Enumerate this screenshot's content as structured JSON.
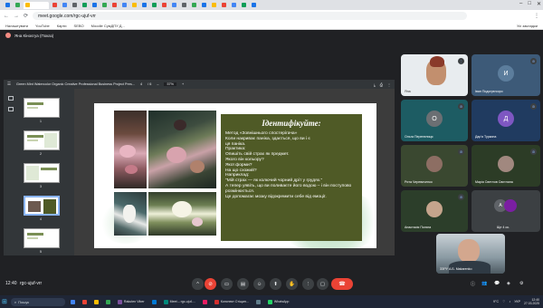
{
  "browser": {
    "tabs": [
      {
        "label": "",
        "color": "#1a73e8"
      },
      {
        "label": "",
        "color": "#34a853"
      },
      {
        "label": "",
        "color": "#fbbc04"
      },
      {
        "label": "",
        "color": "#ea4335"
      },
      {
        "label": "",
        "color": "#4285f4"
      },
      {
        "label": "",
        "color": "#5f6368"
      },
      {
        "label": "",
        "color": "#0f9d58"
      },
      {
        "label": "",
        "color": "#1a73e8"
      },
      {
        "label": "",
        "color": "#34a853"
      },
      {
        "label": "",
        "color": "#ea4335"
      },
      {
        "label": "",
        "color": "#4285f4"
      },
      {
        "label": "",
        "color": "#fbbc04"
      },
      {
        "label": "",
        "color": "#1a73e8"
      },
      {
        "label": "",
        "color": "#0f9d58"
      },
      {
        "label": "",
        "color": "#ea4335"
      },
      {
        "label": "",
        "color": "#4285f4"
      },
      {
        "label": "",
        "color": "#5f6368"
      },
      {
        "label": "",
        "color": "#34a853"
      },
      {
        "label": "",
        "color": "#1a73e8"
      },
      {
        "label": "",
        "color": "#fbbc04"
      },
      {
        "label": "",
        "color": "#ea4335"
      },
      {
        "label": "",
        "color": "#4285f4"
      },
      {
        "label": "",
        "color": "#0f9d58"
      },
      {
        "label": "",
        "color": "#1a73e8"
      }
    ],
    "url": "meet.google.com/rgc-ujuf-vrr",
    "bookmarks": [
      "Налаштувати",
      "YouTube",
      "Карти",
      "SEBO",
      "Moodle СумДПУ Д..."
    ],
    "all_bookmarks": "Усі закладки"
  },
  "meet": {
    "presenter_label": "Яна Кіноєгуа (Показ)",
    "file_name": "Green Mint Watercolor Organic Creative Professional Business Project Pres...",
    "page_current": "4",
    "page_total": "/ 6",
    "zoom": "57%",
    "thumb_numbers": [
      "1",
      "2",
      "3",
      "4",
      "5"
    ],
    "slide": {
      "title": "Ідентифікуйте:",
      "lines": [
        "Метод «Зовнішнього спостерігача»",
        "Коли накриває паніка, здається, що ви і є",
        "ця паніка.",
        "Практика:",
        "Опишіть свій страх як предмет.",
        "Якого він кольору?",
        "Якої форми?",
        "На що схожий?",
        "Наприклад:",
        "\"Мій страх — як колючий чорний дріт у грудях.\"",
        "А тепер уявіть, що ви поливаєте його водою – і він поступово розмінюється.",
        "Це допомагає мозку відокремити себе від емоції."
      ]
    },
    "participants": [
      {
        "name": "Яна",
        "initial": ""
      },
      {
        "name": "Іван Подогрєгсоро",
        "initial": "И"
      },
      {
        "name": "Ольга Перепелиця",
        "initial": "О"
      },
      {
        "name": "Дар'я Туркина",
        "initial": "Д"
      },
      {
        "name": "Рита Черевиченко",
        "initial": ""
      },
      {
        "name": "Марія Светлов Свєтлана",
        "initial": ""
      },
      {
        "name": "Анастасія Поляга",
        "initial": ""
      },
      {
        "name": "Ще 4 ос.",
        "initial": "А"
      },
      {
        "name": "ЗЗРУ А.Б. Makarenko",
        "initial": ""
      }
    ],
    "time": "12:40",
    "meeting_code": "rgc-ujuf-vrr"
  },
  "taskbar": {
    "search_placeholder": "Пошук",
    "apps": [
      {
        "label": "",
        "color": "#4285f4"
      },
      {
        "label": "",
        "color": "#ea4335"
      },
      {
        "label": "",
        "color": "#fbbc04"
      },
      {
        "label": "",
        "color": "#34a853"
      },
      {
        "label": "Rakuten Viber",
        "color": "#7b519d"
      },
      {
        "label": "",
        "color": "#0078d4"
      },
      {
        "label": "Meet – rgc-ujuf-...",
        "color": "#00897b"
      },
      {
        "label": "",
        "color": "#e91e63"
      },
      {
        "label": "Конспект Стіщин...",
        "color": "#d32f2f"
      },
      {
        "label": "",
        "color": "#607d8b"
      },
      {
        "label": "WhatsApp",
        "color": "#25d366"
      }
    ],
    "tray_temp": "9°C",
    "tray_lang": "УКР",
    "clock_time": "12:40",
    "clock_date": "27.03.2025"
  }
}
